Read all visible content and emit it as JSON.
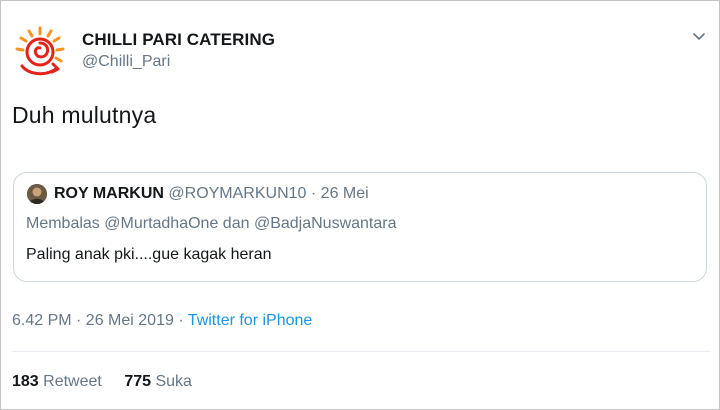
{
  "tweet": {
    "author": {
      "display_name": "CHILLI PARI CATERING",
      "handle": "@Chilli_Pari",
      "avatar_icon": "chilli-spiral-logo-icon"
    },
    "menu_icon": "chevron-down-icon",
    "text": "Duh mulutnya",
    "quoted": {
      "author_name": "ROY MARKUN",
      "author_handle": "@ROYMARKUN10",
      "separator": "·",
      "date": "26 Mei",
      "reply_prefix": "Membalas",
      "reply_mention_1": "@MurtadhaOne",
      "reply_conjunction": "dan",
      "reply_mention_2": "@BadjaNuswantara",
      "text": "Paling anak pki....gue kagak heran"
    },
    "timestamp": "6.42 PM · 26 Mei 2019 ·",
    "source": "Twitter for iPhone",
    "stats": {
      "retweets_count": "183",
      "retweets_label": "Retweet",
      "likes_count": "775",
      "likes_label": "Suka"
    }
  },
  "colors": {
    "link": "#1b95e0",
    "secondary_text": "#657786",
    "primary_text": "#14171a",
    "logo_red": "#e2231a",
    "logo_orange": "#f7931e"
  }
}
